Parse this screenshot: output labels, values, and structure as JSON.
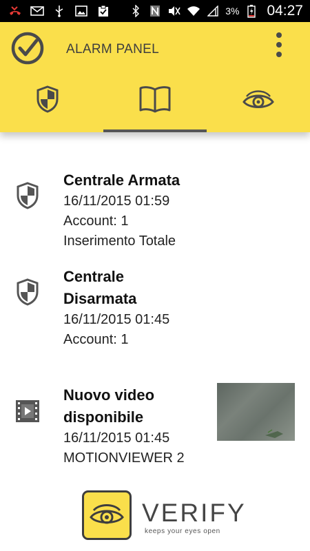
{
  "status_bar": {
    "battery_percent": "3%",
    "time": "04:27",
    "icons_left": [
      "missed-call-icon",
      "mail-icon",
      "usb-icon",
      "image-icon",
      "clipboard-icon"
    ],
    "icons_right": [
      "bluetooth-icon",
      "nfc-icon",
      "mute-icon",
      "wifi-icon",
      "signal-icon",
      "battery-charging-icon"
    ]
  },
  "app_bar": {
    "title": "ALARM PANEL",
    "logo_icon": "check-circle-icon",
    "menu_icon": "overflow-menu-icon",
    "accent_color": "#fadf4b"
  },
  "tabs": [
    {
      "name": "alarm",
      "icon": "shield-icon",
      "selected": false
    },
    {
      "name": "log",
      "icon": "book-icon",
      "selected": true
    },
    {
      "name": "video",
      "icon": "eye-icon",
      "selected": false
    }
  ],
  "events": [
    {
      "icon": "shield-icon",
      "title": "Centrale Armata",
      "lines": [
        "16/11/2015 01:59",
        "Account: 1",
        "Inserimento Totale"
      ]
    },
    {
      "icon": "shield-icon",
      "title_lines": [
        "Centrale",
        "Disarmata"
      ],
      "lines": [
        "16/11/2015 01:45",
        "Account: 1"
      ]
    },
    {
      "icon": "film-icon",
      "title_lines": [
        "Nuovo video",
        "disponibile"
      ],
      "lines": [
        "16/11/2015 01:45",
        "MOTIONVIEWER 2"
      ],
      "has_thumbnail": true
    }
  ],
  "footer": {
    "brand": "VERIFY",
    "tagline": "keeps your eyes open"
  }
}
